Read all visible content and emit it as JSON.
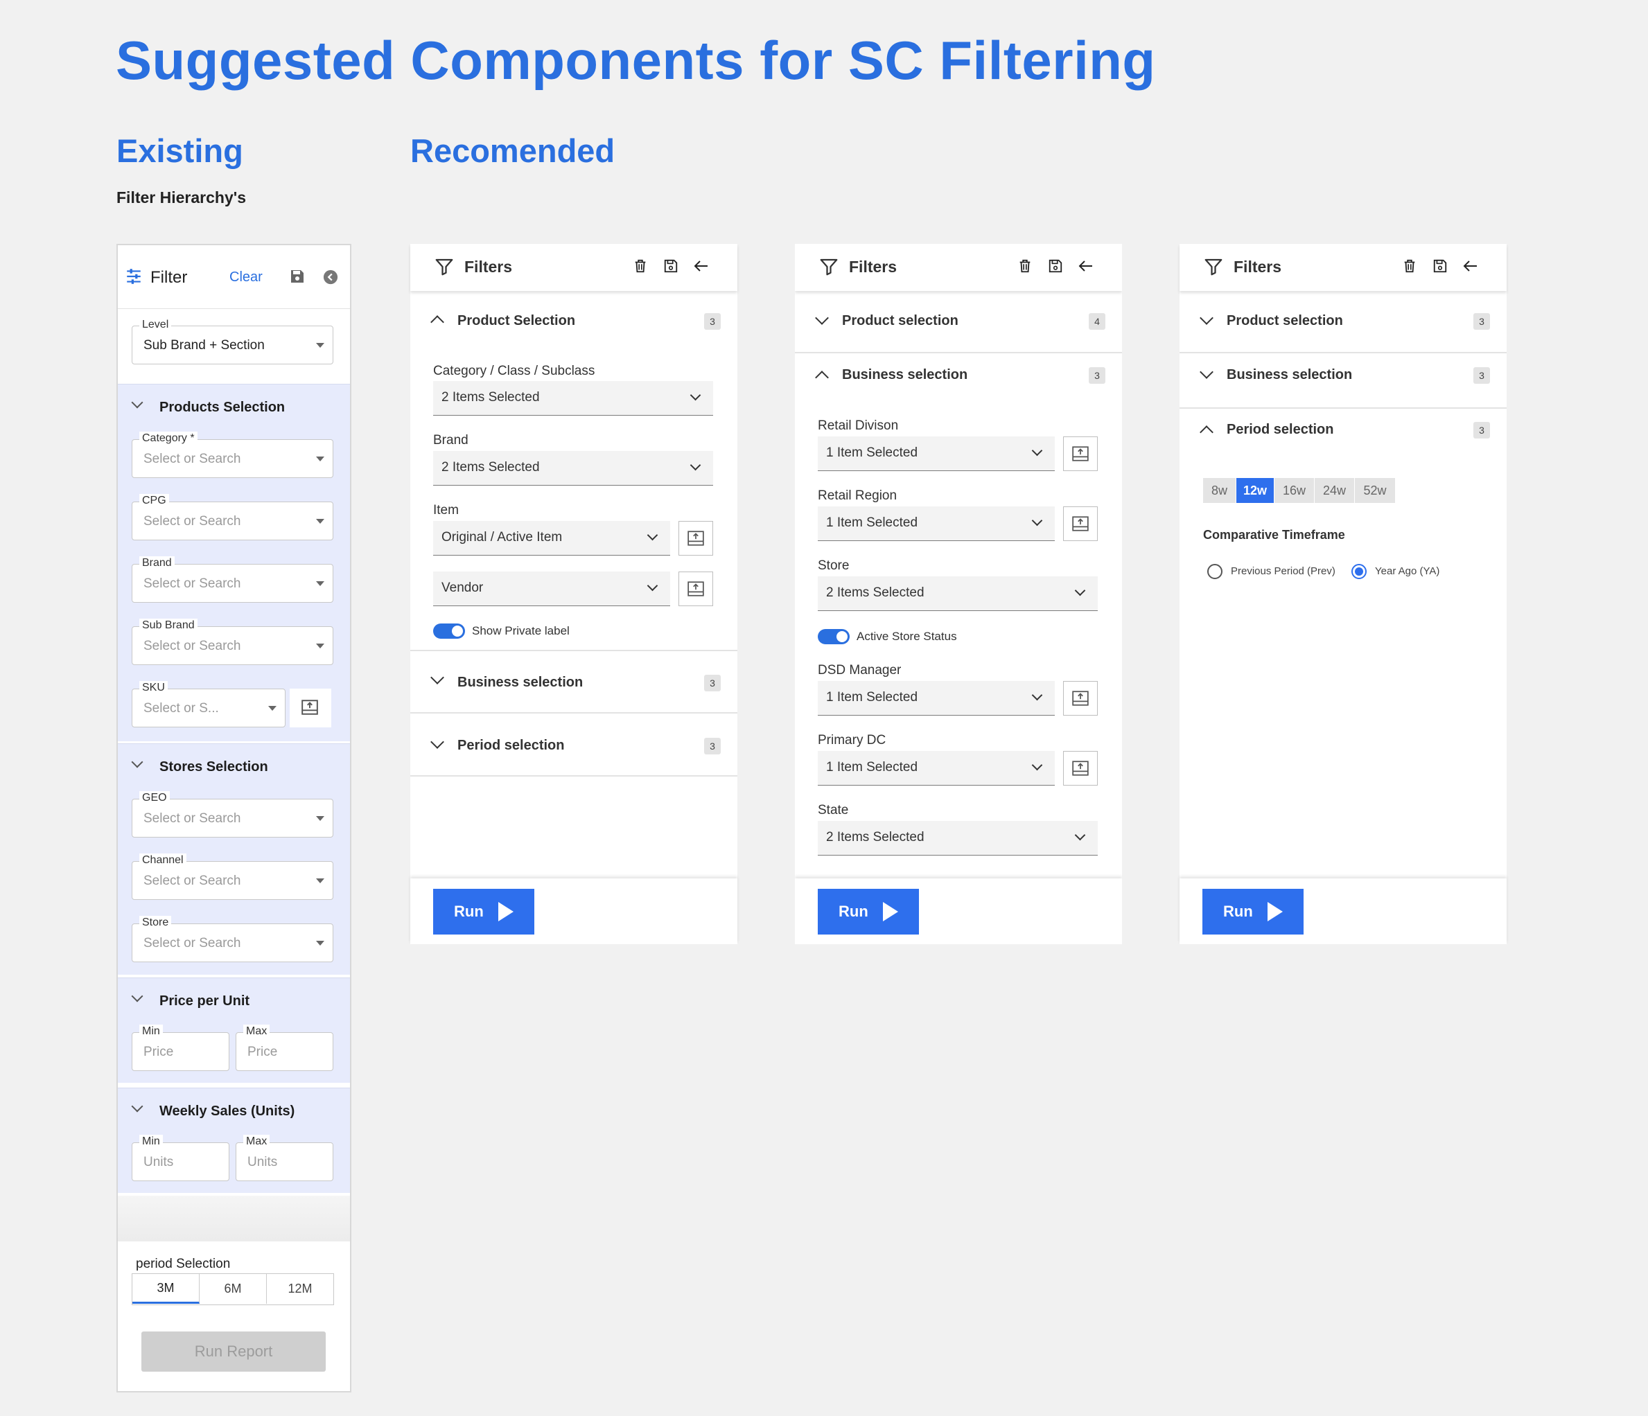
{
  "page": {
    "title": "Suggested Components for SC Filtering",
    "existing_heading": "Existing",
    "recommended_heading": "Recomended",
    "subheading": "Filter Hierarchy's"
  },
  "existing": {
    "header": {
      "title": "Filter",
      "clear": "Clear"
    },
    "level": {
      "label": "Level",
      "value": "Sub Brand + Section"
    },
    "products": {
      "title": "Products Selection",
      "fields": [
        {
          "label": "Category *",
          "placeholder": "Select or Search"
        },
        {
          "label": "CPG",
          "placeholder": "Select or Search"
        },
        {
          "label": "Brand",
          "placeholder": "Select or Search"
        },
        {
          "label": "Sub Brand",
          "placeholder": "Select or Search"
        },
        {
          "label": "SKU",
          "placeholder": "Select or S..."
        }
      ]
    },
    "stores": {
      "title": "Stores Selection",
      "fields": [
        {
          "label": "GEO",
          "placeholder": "Select or Search"
        },
        {
          "label": "Channel",
          "placeholder": "Select or Search"
        },
        {
          "label": "Store",
          "placeholder": "Select or Search"
        }
      ]
    },
    "price": {
      "title": "Price per Unit",
      "min_label": "Min",
      "min_placeholder": "Price",
      "max_label": "Max",
      "max_placeholder": "Price"
    },
    "weekly": {
      "title": "Weekly Sales (Units)",
      "min_label": "Min",
      "min_placeholder": "Units",
      "max_label": "Max",
      "max_placeholder": "Units"
    },
    "period": {
      "title": "period Selection",
      "options": [
        "3M",
        "6M",
        "12M"
      ],
      "selected": "3M"
    },
    "run_report": "Run Report"
  },
  "panel1": {
    "title": "Filters",
    "product": {
      "title": "Product Selection",
      "count": "3"
    },
    "category": {
      "label": "Category / Class /  Subclass",
      "value": "2 Items Selected"
    },
    "brand": {
      "label": "Brand",
      "value": "2 Items Selected"
    },
    "item": {
      "label": "Item",
      "value": "Original / Active Item"
    },
    "vendor": {
      "value": "Vendor"
    },
    "private_label": "Show Private label",
    "business": {
      "title": "Business selection",
      "count": "3"
    },
    "period": {
      "title": "Period selection",
      "count": "3"
    },
    "run": "Run"
  },
  "panel2": {
    "title": "Filters",
    "product": {
      "title": "Product selection",
      "count": "4"
    },
    "business": {
      "title": "Business selection",
      "count": "3"
    },
    "retail_division": {
      "label": "Retail Divison",
      "value": "1 Item Selected"
    },
    "retail_region": {
      "label": "Retail Region",
      "value": "1 Item Selected"
    },
    "store": {
      "label": "Store",
      "value": "2 Items Selected"
    },
    "active_store": "Active Store Status",
    "dsd_manager": {
      "label": "DSD Manager",
      "value": "1 Item Selected"
    },
    "primary_dc": {
      "label": "Primary DC",
      "value": "1 Item Selected"
    },
    "state": {
      "label": "State",
      "value": "2 Items Selected"
    },
    "run": "Run"
  },
  "panel3": {
    "title": "Filters",
    "product": {
      "title": "Product selection",
      "count": "3"
    },
    "business": {
      "title": "Business selection",
      "count": "3"
    },
    "period": {
      "title": "Period selection",
      "count": "3"
    },
    "weeks": [
      "8w",
      "12w",
      "16w",
      "24w",
      "52w"
    ],
    "selected_week": "12w",
    "comparative": {
      "title": "Comparative Timeframe",
      "options": [
        "Previous Period (Prev)",
        "Year Ago (YA)"
      ],
      "selected": "Year Ago (YA)"
    },
    "run": "Run"
  },
  "colors": {
    "accent": "#2a6fdf",
    "button": "#2e6fed",
    "existing_section_bg": "#e7ebfc",
    "page_bg": "#f1f1f1"
  },
  "icons": [
    "filter-icon",
    "trash-icon",
    "save-icon",
    "arrow-left-icon",
    "chevron-down-icon",
    "chevron-up-icon",
    "upload-icon",
    "play-icon",
    "sliders-icon",
    "back-circle-icon"
  ]
}
